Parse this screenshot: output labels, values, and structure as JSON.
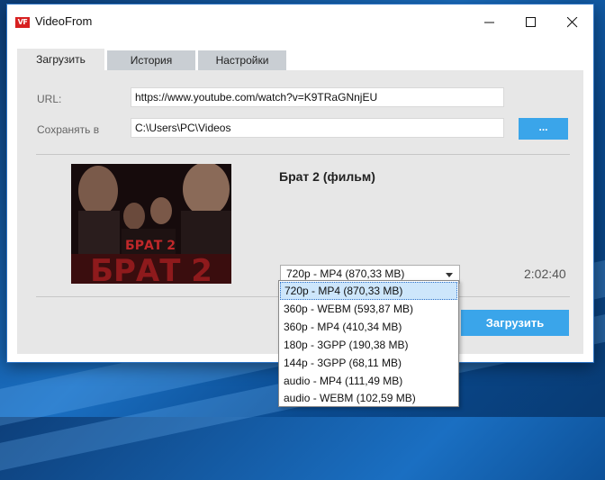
{
  "window": {
    "title": "VideoFrom",
    "icon_text": "VF"
  },
  "tabs": [
    {
      "label": "Загрузить",
      "active": true
    },
    {
      "label": "История",
      "active": false
    },
    {
      "label": "Настройки",
      "active": false
    }
  ],
  "form": {
    "url_label": "URL:",
    "url_value": "https://www.youtube.com/watch?v=K9TRaGNnjEU",
    "save_label": "Сохранять в",
    "save_value": "C:\\Users\\PC\\Videos",
    "browse_label": "..."
  },
  "video": {
    "title": "Брат 2 (фильм)",
    "duration": "2:02:40",
    "poster_text_small": "БРАТ 2",
    "poster_text_large": "БРАТ 2"
  },
  "format_select": {
    "selected": "720p - MP4 (870,33 MB)",
    "options": [
      "720p - MP4 (870,33 MB)",
      "360p - WEBM (593,87 MB)",
      "360p - MP4 (410,34 MB)",
      "180p - 3GPP (190,38 MB)",
      "144p - 3GPP (68,11 MB)",
      "audio - MP4 (111,49 MB)",
      "audio - WEBM (102,59 MB)"
    ]
  },
  "download_label": "Загрузить",
  "colors": {
    "accent": "#3aa5ea",
    "panel": "#e7e7e7",
    "app_icon": "#d72020"
  }
}
